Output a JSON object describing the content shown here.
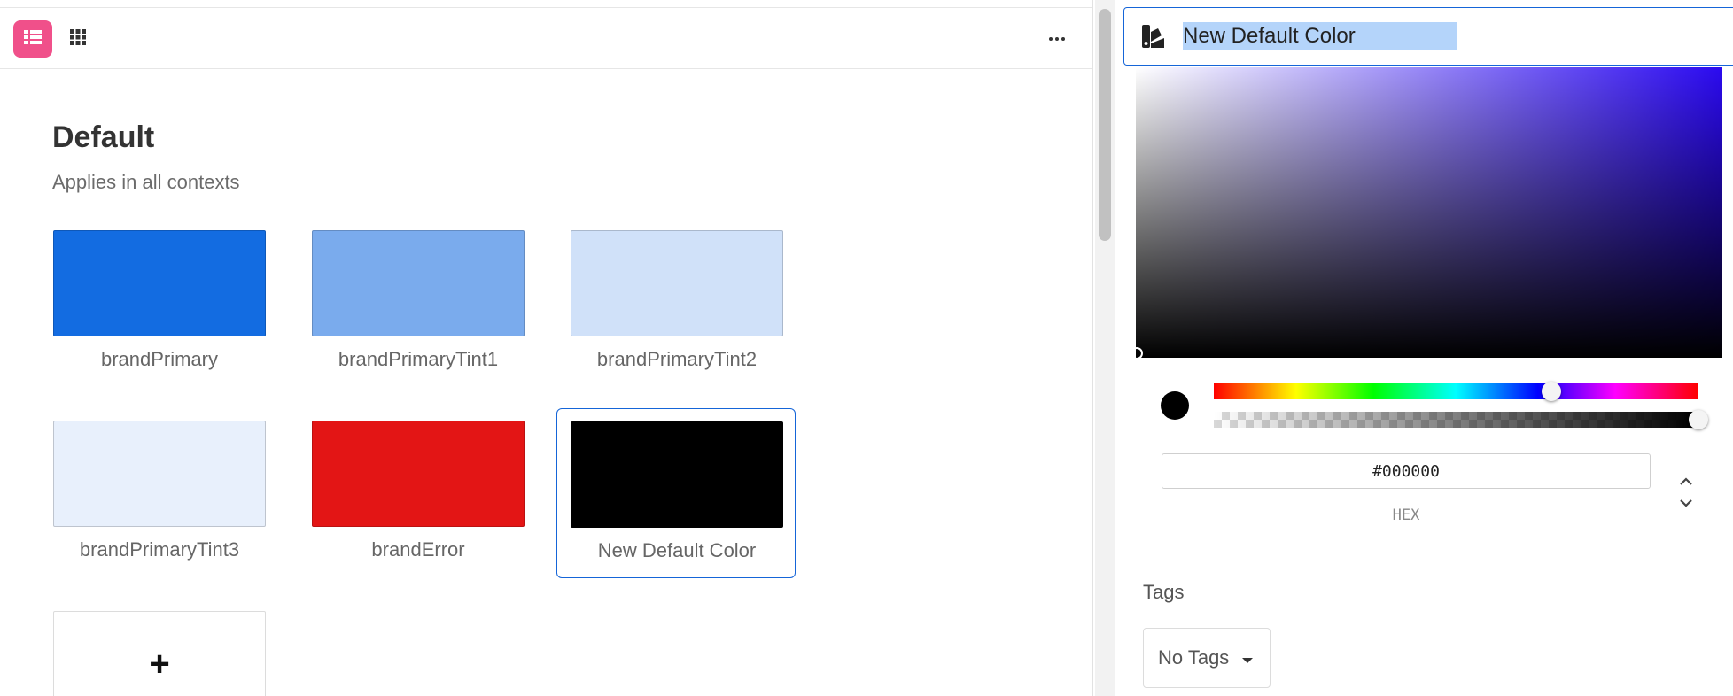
{
  "toolbar": {
    "list_view_icon": "list-icon",
    "grid_view_icon": "grid-icon",
    "more_icon": "more-horizontal-icon"
  },
  "section": {
    "title": "Default",
    "subtitle": "Applies in all contexts"
  },
  "colors": [
    {
      "name": "brandPrimary",
      "hex": "#136ce1"
    },
    {
      "name": "brandPrimaryTint1",
      "hex": "#7aabed"
    },
    {
      "name": "brandPrimaryTint2",
      "hex": "#d0e1f9"
    },
    {
      "name": "brandPrimaryTint3",
      "hex": "#e8f0fc"
    },
    {
      "name": "brandError",
      "hex": "#e31515"
    },
    {
      "name": "New Default Color",
      "hex": "#000000"
    }
  ],
  "add_card": {
    "label": "+",
    "icon": "plus-icon"
  },
  "editor": {
    "name_icon": "color-swatch-icon",
    "name_value": "New Default Color",
    "hex_value": "#000000",
    "format_label": "HEX",
    "format_toggle_icon": "chevron-up-down-icon",
    "tags_label": "Tags",
    "tags_value": "No Tags",
    "tags_dropdown_icon": "caret-down-icon"
  }
}
